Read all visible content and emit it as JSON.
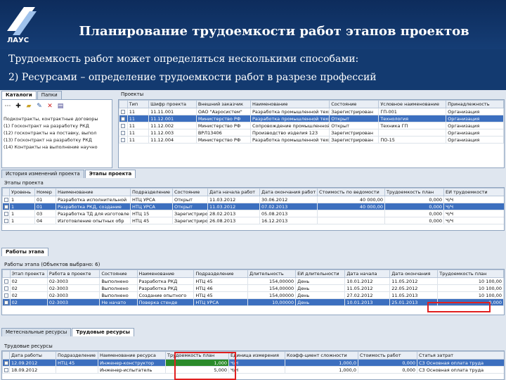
{
  "header": {
    "logo_text": "ЛАУС",
    "title": "Планирование трудоемкости работ этапов проектов"
  },
  "intro": {
    "line1": "Трудоемкость работ может определяться несколькими способами:",
    "line2": "2)  Ресурсами – определение трудоемкости работ в разрезе профессий"
  },
  "top_tabs": [
    "Каталоги",
    "Папки"
  ],
  "projects_label": "Проекты",
  "tree_items": [
    "Подконтракты, контрактные договоры",
    "(1) Госконтракт на разработку РКД",
    "(12) госконтракты на поставку, выпол",
    "(13) Госконтракт на разработку РКД",
    "(14) Контракты на выполнение научно"
  ],
  "projects_table": {
    "headers": [
      "Тип",
      "Шифр проекта",
      "Внешний заказчик",
      "Наименование",
      "Состояние",
      "Условное наименование",
      "Принадлежность"
    ],
    "rows": [
      [
        "11",
        "11.11.001",
        "ОАО \"Аэросистем\"",
        "Разработка промышленной технологии",
        "Зарегистрирован",
        "ГП-001",
        "Организация"
      ],
      [
        "11",
        "11.12.001",
        "Министерство РФ",
        "Разработка промышленной технологии",
        "Открыт",
        "Технология",
        "Организация"
      ],
      [
        "11",
        "11.12.002",
        "Министерство РФ",
        "Сопровождение промышленной техники",
        "Открыт",
        "Техника ГП",
        "Организация"
      ],
      [
        "11",
        "11.12.003",
        "ВРЛ13406",
        "Производство изделия 123",
        "Зарегистрирован",
        "",
        "Организация"
      ],
      [
        "11",
        "11.12.004",
        "Министерство РФ",
        "Разработка промышленной техники",
        "Зарегистрирован",
        "ПО-15",
        "Организация"
      ]
    ]
  },
  "mid_tabs": [
    "История изменений проекта",
    "Этапы проекта"
  ],
  "stages_label": "Этапы проекта",
  "stages_table": {
    "headers": [
      "Уровень",
      "Номер",
      "Наименование",
      "Подразделение",
      "Состояние",
      "Дата начала работ",
      "Дата окончания работ",
      "Стоимость по ведомости",
      "Трудоемкость план",
      "ЕИ трудоемкости"
    ],
    "rows": [
      [
        "1",
        "01",
        "Разработка исполнительной",
        "НТЦ УРСА",
        "Открыт",
        "11.03.2012",
        "30.06.2012",
        "40 000,00",
        "0,000",
        "Ч/Ч"
      ],
      [
        "1",
        "01",
        "Разработка РКД, создание",
        "НТЦ УРСА",
        "Открыт",
        "11.03.2012",
        "07.02.2013",
        "40 000,00",
        "0,000",
        "Ч/Ч"
      ],
      [
        "1",
        "03",
        "Разработка ТД для изготовле",
        "НТЦ 15",
        "Зарегистрирован",
        "28.02.2013",
        "05.08.2013",
        "",
        "0,000",
        "Ч/Ч"
      ],
      [
        "1",
        "04",
        "Изготовление опытных обр",
        "НТЦ 45",
        "Зарегистрирован",
        "26.08.2013",
        "16.12.2013",
        "",
        "0,000",
        "Ч/Ч"
      ]
    ]
  },
  "works_tabs": [
    "Работы этапа"
  ],
  "works_label": "Работы этапа (Объектов выбрано: 6)",
  "works_table": {
    "headers": [
      "Этап проекта",
      "Работа в проекте",
      "Состояние",
      "Наименование",
      "Подразделение",
      "Длительность",
      "ЕИ длительности",
      "Дата начала",
      "Дата окончания",
      "Трудоемкость план"
    ],
    "rows": [
      [
        "02",
        "02-3003",
        "Выполнено",
        "Разработка РКД",
        "НТЦ 45",
        "154,00000",
        "День",
        "10.01.2012",
        "11.05.2012",
        "10 100,00"
      ],
      [
        "02",
        "02-3003",
        "Выполнено",
        "Разработка РКД",
        "НТЦ 46",
        "154,00000",
        "День",
        "11.05.2012",
        "22.05.2012",
        "10 100,00"
      ],
      [
        "02",
        "02-3003",
        "Выполнено",
        "Создание опытного",
        "НТЦ 45",
        "154,00000",
        "День",
        "27.02.2012",
        "11.05.2013",
        "10 100,00"
      ],
      [
        "02",
        "02-3003",
        "Не начато",
        "Поверка стенде",
        "НТЦ УРСА",
        "10,00000",
        "День",
        "10.01.2013",
        "25.01.2013",
        "0,000"
      ]
    ]
  },
  "bottom_tabs": [
    "Метеснальные ресурсы",
    "Трудовые ресурсы"
  ],
  "labor_label": "Трудовые ресурсы",
  "labor_table": {
    "headers": [
      "Дата работы",
      "Подразделение",
      "Наименование ресурса",
      "Трудоемкость план",
      "Единица измерения",
      "Коэфф-циент сложности",
      "Стоимость работ",
      "Статья затрат"
    ],
    "rows": [
      [
        "12.09.2012",
        "НТЦ 45",
        "Инженер-конструктор",
        "1,000",
        "Ч/Ч",
        "1,000,0",
        "0,000",
        "С3 Основная оплата труда"
      ],
      [
        "18.09.2012",
        "",
        "Инженер-испытатель",
        "5,000",
        "Ч/Ч",
        "1,000,0",
        "0,000",
        "С3 Основная оплата труда"
      ]
    ]
  },
  "colors": {
    "header_bg": "#0d2c5c",
    "selection": "#3c6fbf",
    "highlight_box": "#e02020",
    "fill_green": "#2a8a2a"
  }
}
